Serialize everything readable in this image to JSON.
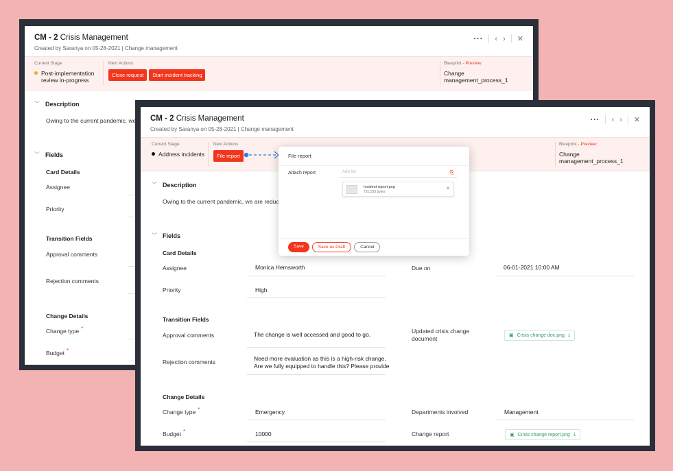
{
  "back": {
    "title_id": "CM - 2",
    "title_name": "Crisis Management",
    "subtitle": "Created by Saranya on 05-28-2021 | Change management",
    "controls": {
      "more": "···",
      "prev": "‹",
      "next": "›",
      "close": "✕"
    },
    "stage_label": "Current Stage",
    "stage_value": "Post-implementation review in-progress",
    "next_actions_label": "Next Actions",
    "actions": [
      "Close request",
      "Start incident tracking"
    ],
    "blueprint_label": "Blueprint",
    "blueprint_preview": "- Preview",
    "blueprint_value": "Change management_process_1",
    "description_heading": "Description",
    "description_text": "Owing to the current pandemic, we are",
    "fields_heading": "Fields",
    "card_details": "Card Details",
    "assignee_label": "Assignee",
    "priority_label": "Priority",
    "transition_fields": "Transition Fields",
    "approval_label": "Approval comments",
    "rejection_label": "Rejection comments",
    "change_details": "Change Details",
    "change_type_label": "Change type",
    "budget_label": "Budget",
    "required_mark": "*"
  },
  "front": {
    "title_id": "CM - 2",
    "title_name": "Crisis Management",
    "subtitle": "Created by Saranya on 05-28-2021 | Change management",
    "controls": {
      "more": "···",
      "prev": "‹",
      "next": "›",
      "close": "✕"
    },
    "stage_label": "Current Stage",
    "stage_value": "Address incidents",
    "next_actions_label": "Next Actions",
    "action": "File report",
    "blueprint_label": "Blueprint",
    "blueprint_preview": "- Preview",
    "blueprint_value": "Change management_process_1",
    "description_heading": "Description",
    "description_text": "Owing to the current pandemic, we are reducing t",
    "fields_heading": "Fields",
    "card_details": "Card Details",
    "assignee_label": "Assignee",
    "assignee_value": "Monica Hemsworth",
    "due_label": "Due on",
    "due_value": "06-01-2021 10:00 AM",
    "priority_label": "Priority",
    "priority_value": "High",
    "transition_fields": "Transition Fields",
    "approval_label": "Approval comments",
    "approval_value": "The change is well accessed and good to go.",
    "updated_doc_label": "Updated crisis change document",
    "updated_doc_file": "Crisis change doc.png",
    "rejection_label": "Rejection comments",
    "rejection_value_1": "Need more evaluation as this is a high-risk change.",
    "rejection_value_2": "Are we fully equipped to handle this? Please provide",
    "change_details": "Change Details",
    "change_type_label": "Change type",
    "change_type_value": "Emergency",
    "departments_label": "Departments involved",
    "departments_value": "Management",
    "budget_label": "Budget",
    "budget_value": "10000",
    "change_report_label": "Change report",
    "change_report_file": "Crisis change report.png",
    "required_mark": "*"
  },
  "modal": {
    "title": "File report",
    "attach_label": "Attach report",
    "input_placeholder": "Add file",
    "file_name": "Incident report.png",
    "file_size": "731.533 bytes",
    "buttons": {
      "save": "Save",
      "draft": "Save as Draft",
      "cancel": "Cancel"
    }
  },
  "colors": {
    "accent": "#f2351d",
    "background": "#f4b3b3",
    "frame": "#2a2f3a",
    "stage_bg": "#fdf0ee",
    "file_green": "#2f9e63"
  }
}
